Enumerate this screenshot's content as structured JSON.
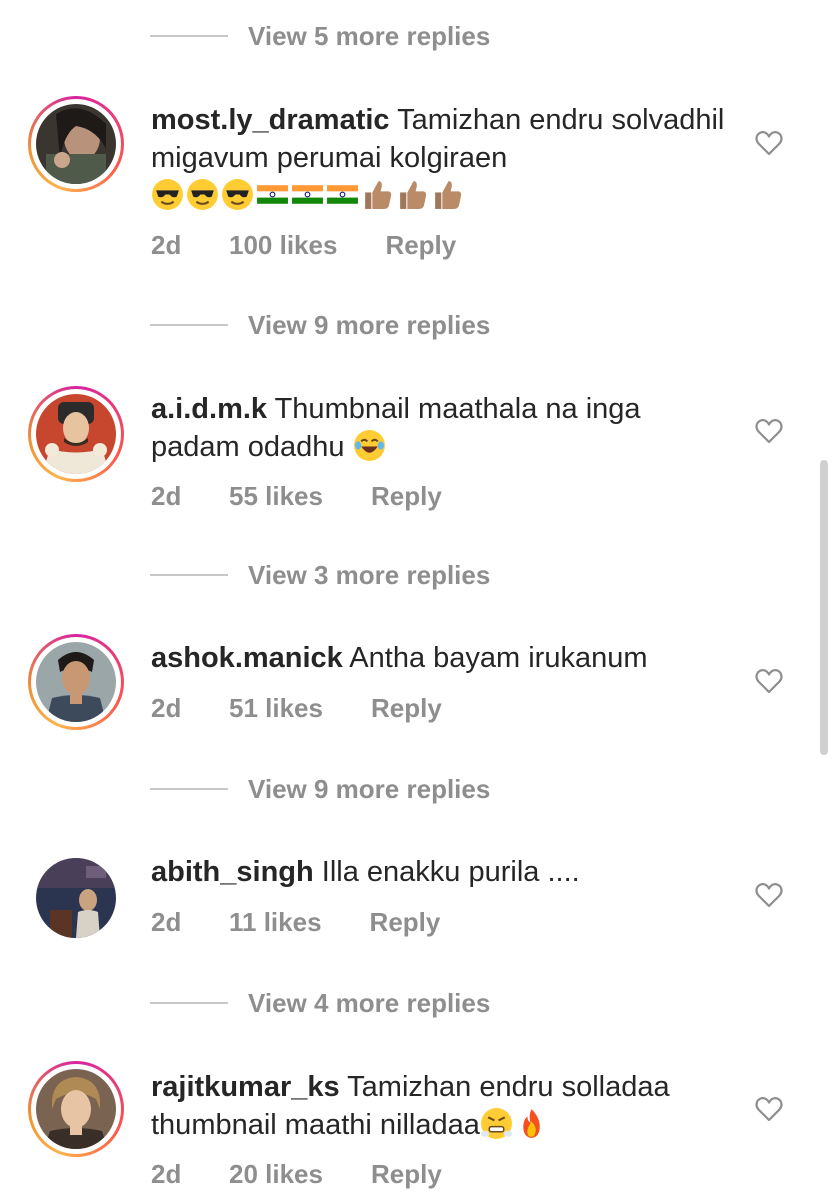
{
  "view_replies": [
    {
      "label": "View 5 more replies"
    },
    {
      "label": "View 9 more replies"
    },
    {
      "label": "View 3 more replies"
    },
    {
      "label": "View 9 more replies"
    },
    {
      "label": "View 4 more replies"
    }
  ],
  "comments": [
    {
      "username": "most.ly_dramatic",
      "text": "Tamizhan endru solvadhil migavum perumai kolgiraen",
      "emoji_line": [
        "sunglasses-emoji",
        "sunglasses-emoji",
        "sunglasses-emoji",
        "india-flag-emoji",
        "india-flag-emoji",
        "india-flag-emoji",
        "thumbs-up-emoji",
        "thumbs-up-emoji",
        "thumbs-up-emoji"
      ],
      "time": "2d",
      "likes": "100 likes",
      "reply": "Reply"
    },
    {
      "username": "a.i.d.m.k",
      "text": "Thumbnail maathala na inga padam odadhu",
      "trailing_emoji": "laughing-tears-emoji",
      "time": "2d",
      "likes": "55 likes",
      "reply": "Reply"
    },
    {
      "username": "ashok.manick",
      "text": "Antha bayam irukanum",
      "time": "2d",
      "likes": "51 likes",
      "reply": "Reply"
    },
    {
      "username": "abith_singh",
      "text": "Illa enakku purila ....",
      "time": "2d",
      "likes": "11 likes",
      "reply": "Reply"
    },
    {
      "username": "rajitkumar_ks",
      "text": "Tamizhan endru solladaa thumbnail maathi nilladaa",
      "trailing_emoji": [
        "steam-from-nose-emoji",
        "fire-emoji"
      ],
      "time": "2d",
      "likes": "20 likes",
      "reply": "Reply"
    }
  ],
  "icons": {
    "like": "heart-outline-icon"
  },
  "colors": {
    "text": "#262626",
    "secondary": "#8e8e8e",
    "story_ring": "#d6249f"
  }
}
